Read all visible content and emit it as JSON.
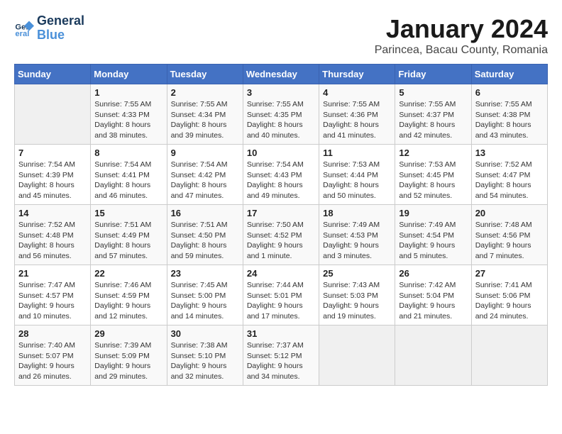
{
  "header": {
    "logo_line1": "General",
    "logo_line2": "Blue",
    "month": "January 2024",
    "location": "Parincea, Bacau County, Romania"
  },
  "weekdays": [
    "Sunday",
    "Monday",
    "Tuesday",
    "Wednesday",
    "Thursday",
    "Friday",
    "Saturday"
  ],
  "weeks": [
    [
      {
        "day": "",
        "info": ""
      },
      {
        "day": "1",
        "info": "Sunrise: 7:55 AM\nSunset: 4:33 PM\nDaylight: 8 hours\nand 38 minutes."
      },
      {
        "day": "2",
        "info": "Sunrise: 7:55 AM\nSunset: 4:34 PM\nDaylight: 8 hours\nand 39 minutes."
      },
      {
        "day": "3",
        "info": "Sunrise: 7:55 AM\nSunset: 4:35 PM\nDaylight: 8 hours\nand 40 minutes."
      },
      {
        "day": "4",
        "info": "Sunrise: 7:55 AM\nSunset: 4:36 PM\nDaylight: 8 hours\nand 41 minutes."
      },
      {
        "day": "5",
        "info": "Sunrise: 7:55 AM\nSunset: 4:37 PM\nDaylight: 8 hours\nand 42 minutes."
      },
      {
        "day": "6",
        "info": "Sunrise: 7:55 AM\nSunset: 4:38 PM\nDaylight: 8 hours\nand 43 minutes."
      }
    ],
    [
      {
        "day": "7",
        "info": "Sunrise: 7:54 AM\nSunset: 4:39 PM\nDaylight: 8 hours\nand 45 minutes."
      },
      {
        "day": "8",
        "info": "Sunrise: 7:54 AM\nSunset: 4:41 PM\nDaylight: 8 hours\nand 46 minutes."
      },
      {
        "day": "9",
        "info": "Sunrise: 7:54 AM\nSunset: 4:42 PM\nDaylight: 8 hours\nand 47 minutes."
      },
      {
        "day": "10",
        "info": "Sunrise: 7:54 AM\nSunset: 4:43 PM\nDaylight: 8 hours\nand 49 minutes."
      },
      {
        "day": "11",
        "info": "Sunrise: 7:53 AM\nSunset: 4:44 PM\nDaylight: 8 hours\nand 50 minutes."
      },
      {
        "day": "12",
        "info": "Sunrise: 7:53 AM\nSunset: 4:45 PM\nDaylight: 8 hours\nand 52 minutes."
      },
      {
        "day": "13",
        "info": "Sunrise: 7:52 AM\nSunset: 4:47 PM\nDaylight: 8 hours\nand 54 minutes."
      }
    ],
    [
      {
        "day": "14",
        "info": "Sunrise: 7:52 AM\nSunset: 4:48 PM\nDaylight: 8 hours\nand 56 minutes."
      },
      {
        "day": "15",
        "info": "Sunrise: 7:51 AM\nSunset: 4:49 PM\nDaylight: 8 hours\nand 57 minutes."
      },
      {
        "day": "16",
        "info": "Sunrise: 7:51 AM\nSunset: 4:50 PM\nDaylight: 8 hours\nand 59 minutes."
      },
      {
        "day": "17",
        "info": "Sunrise: 7:50 AM\nSunset: 4:52 PM\nDaylight: 9 hours\nand 1 minute."
      },
      {
        "day": "18",
        "info": "Sunrise: 7:49 AM\nSunset: 4:53 PM\nDaylight: 9 hours\nand 3 minutes."
      },
      {
        "day": "19",
        "info": "Sunrise: 7:49 AM\nSunset: 4:54 PM\nDaylight: 9 hours\nand 5 minutes."
      },
      {
        "day": "20",
        "info": "Sunrise: 7:48 AM\nSunset: 4:56 PM\nDaylight: 9 hours\nand 7 minutes."
      }
    ],
    [
      {
        "day": "21",
        "info": "Sunrise: 7:47 AM\nSunset: 4:57 PM\nDaylight: 9 hours\nand 10 minutes."
      },
      {
        "day": "22",
        "info": "Sunrise: 7:46 AM\nSunset: 4:59 PM\nDaylight: 9 hours\nand 12 minutes."
      },
      {
        "day": "23",
        "info": "Sunrise: 7:45 AM\nSunset: 5:00 PM\nDaylight: 9 hours\nand 14 minutes."
      },
      {
        "day": "24",
        "info": "Sunrise: 7:44 AM\nSunset: 5:01 PM\nDaylight: 9 hours\nand 17 minutes."
      },
      {
        "day": "25",
        "info": "Sunrise: 7:43 AM\nSunset: 5:03 PM\nDaylight: 9 hours\nand 19 minutes."
      },
      {
        "day": "26",
        "info": "Sunrise: 7:42 AM\nSunset: 5:04 PM\nDaylight: 9 hours\nand 21 minutes."
      },
      {
        "day": "27",
        "info": "Sunrise: 7:41 AM\nSunset: 5:06 PM\nDaylight: 9 hours\nand 24 minutes."
      }
    ],
    [
      {
        "day": "28",
        "info": "Sunrise: 7:40 AM\nSunset: 5:07 PM\nDaylight: 9 hours\nand 26 minutes."
      },
      {
        "day": "29",
        "info": "Sunrise: 7:39 AM\nSunset: 5:09 PM\nDaylight: 9 hours\nand 29 minutes."
      },
      {
        "day": "30",
        "info": "Sunrise: 7:38 AM\nSunset: 5:10 PM\nDaylight: 9 hours\nand 32 minutes."
      },
      {
        "day": "31",
        "info": "Sunrise: 7:37 AM\nSunset: 5:12 PM\nDaylight: 9 hours\nand 34 minutes."
      },
      {
        "day": "",
        "info": ""
      },
      {
        "day": "",
        "info": ""
      },
      {
        "day": "",
        "info": ""
      }
    ]
  ]
}
